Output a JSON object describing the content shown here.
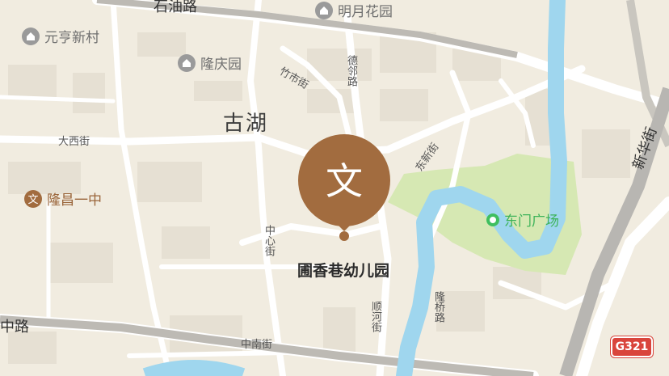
{
  "map": {
    "district": "古湖",
    "pois": [
      {
        "name": "元亨新村",
        "icon": "building-icon"
      },
      {
        "name": "隆庆园",
        "icon": "building-icon"
      },
      {
        "name": "明月花园",
        "icon": "building-icon"
      },
      {
        "name": "隆昌一中",
        "icon": "school-icon"
      },
      {
        "name": "东门广场",
        "icon": "square-icon"
      }
    ],
    "roads": {
      "shiyou": "石油路",
      "zhushi": "竹市街",
      "delin": "德邻路",
      "daxi": "大西街",
      "dongxin": "东新街",
      "xinhua": "新华街",
      "zhongxin": "中心街",
      "zhonglu": "中路",
      "zhongnan": "中南街",
      "shunhe": "顺河街",
      "longqiao": "隆桥路"
    },
    "highway_shield": "G321",
    "selected_place": {
      "name": "圃香巷幼儿园",
      "category_glyph": "文",
      "icon": "school-icon"
    },
    "colors": {
      "land": "#f1ece0",
      "road": "#ffffff",
      "river": "#9fd6ee",
      "park": "#d6e8b3",
      "pin": "#a26c3f",
      "highway": "#d9453c"
    }
  }
}
